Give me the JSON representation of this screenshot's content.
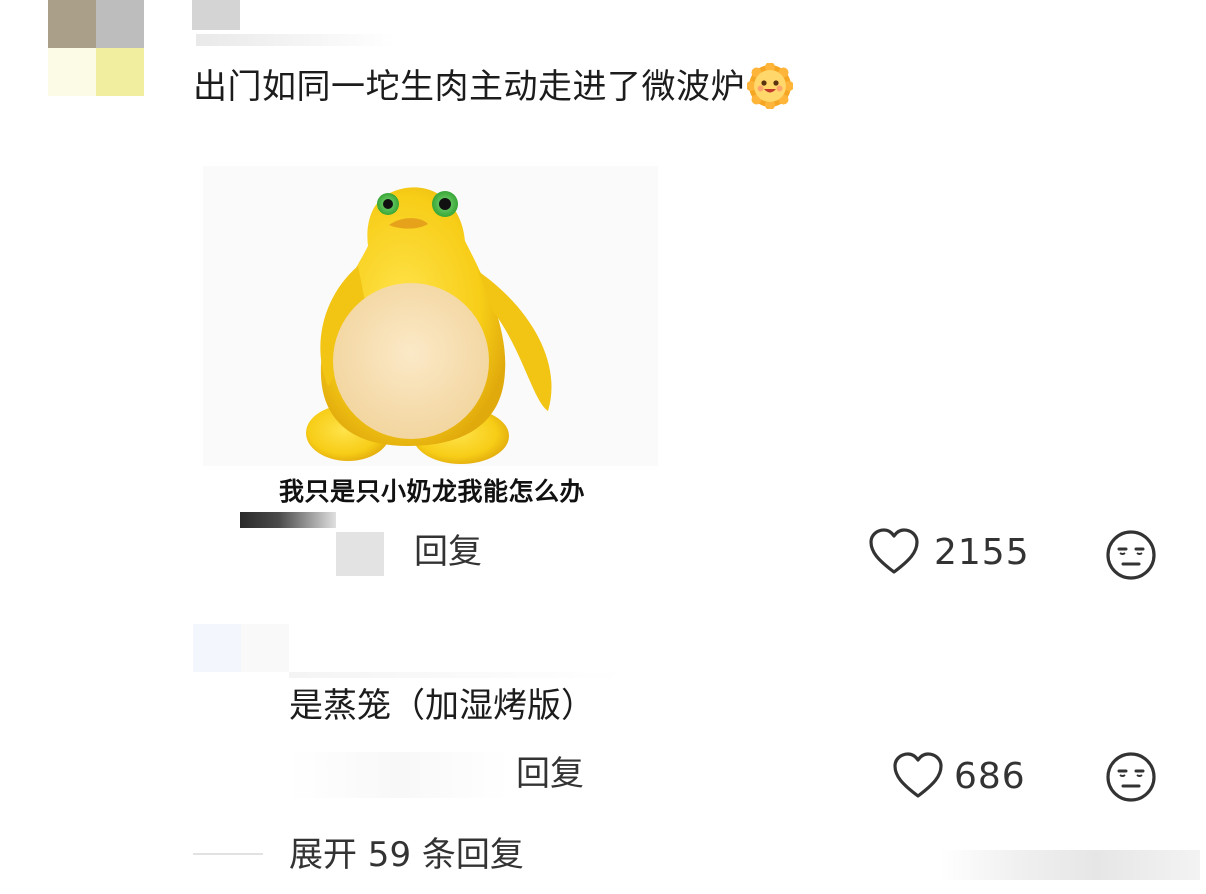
{
  "main_comment": {
    "text": "出门如同一坨生肉主动走进了微波炉",
    "emoji_icon": "smiling-sun-emoji",
    "meme": {
      "caption": "我只是只小奶龙我能怎么办",
      "character": "yellow-penguin-figure"
    },
    "reply_label": "回复",
    "like_count": "2155"
  },
  "sub_reply": {
    "text": "是蒸笼（加湿烤版）",
    "reply_label": "回复",
    "like_count": "686"
  },
  "expand": {
    "label": "展开 59 条回复"
  },
  "colors": {
    "text": "#1c1c1c",
    "meta": "#333333",
    "penguin_yellow": "#f5cf1f",
    "penguin_belly": "#f7deb0"
  }
}
